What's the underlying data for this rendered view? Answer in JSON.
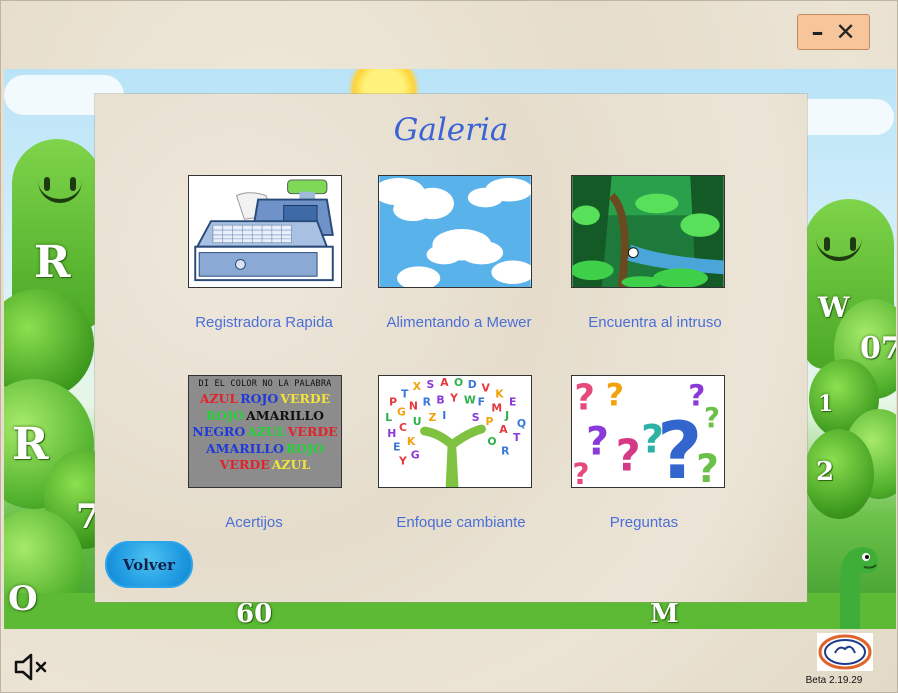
{
  "window": {
    "minimize_label": "–",
    "close_label": "✕"
  },
  "title": "Galeria",
  "gallery": [
    {
      "label": "Registradora Rapida",
      "icon": "cash-register-icon"
    },
    {
      "label": "Alimentando a Mewer",
      "icon": "clouds-icon"
    },
    {
      "label": "Encuentra al intruso",
      "icon": "jungle-icon"
    },
    {
      "label": "Acertijos",
      "icon": "color-words-icon"
    },
    {
      "label": "Enfoque cambiante",
      "icon": "letter-tree-icon"
    },
    {
      "label": "Preguntas",
      "icon": "question-marks-icon"
    }
  ],
  "stroop": {
    "header": "DI EL COLOR NO LA PALABRA",
    "rows": [
      [
        [
          "AZUL",
          "#e0242a"
        ],
        [
          "ROJO",
          "#1e3ad8"
        ],
        [
          "VERDE",
          "#f2e33a"
        ]
      ],
      [
        [
          "ROJO",
          "#27d33a"
        ],
        [
          "AMARILLO",
          "#111111"
        ]
      ],
      [
        [
          "NEGRO",
          "#1e3ad8"
        ],
        [
          "AZUL",
          "#27d33a"
        ],
        [
          "VERDE",
          "#e0242a"
        ]
      ],
      [
        [
          "AMARILLO",
          "#1e3ad8"
        ],
        [
          "ROJO",
          "#27d33a"
        ]
      ],
      [
        [
          "VERDE",
          "#e0242a"
        ],
        [
          "AZUL",
          "#f2e33a"
        ]
      ]
    ]
  },
  "scene_letters": [
    "R",
    "R",
    "7",
    "O",
    "60",
    "W",
    "07",
    "1",
    "2",
    "M"
  ],
  "back_button": "Volver",
  "version": "Beta 2.19.29",
  "colors": {
    "title": "#3a63d6",
    "label": "#4a6fd8",
    "button": "#1c97e0",
    "window_button": "#f7c59a"
  }
}
